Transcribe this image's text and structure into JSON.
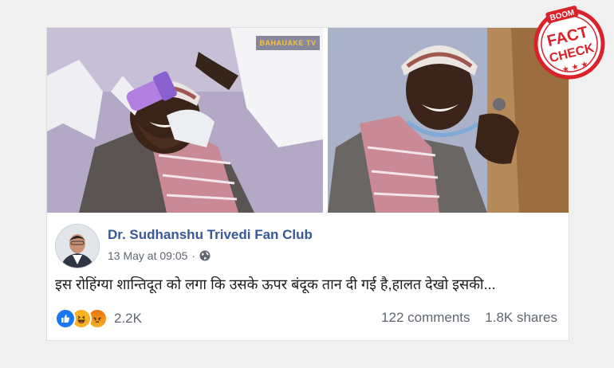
{
  "watermark": "BAHAUAKE TV",
  "post": {
    "page_name": "Dr. Sudhanshu Trivedi Fan Club",
    "timestamp": "13 May at 09:05",
    "separator": "·",
    "text": "इस रोहिंग्या शान्तिदूत को लगा कि उसके ऊपर बंदूक तान दी गई है,हालत देखो इसकी..."
  },
  "engagement": {
    "reactions": [
      "like-icon",
      "haha-icon",
      "angry-icon"
    ],
    "reaction_count": "2.2K",
    "comments": "122 comments",
    "shares": "1.8K shares"
  },
  "stamp": {
    "brand": "BOOM",
    "line1": "FACT",
    "line2": "CHECK",
    "color": "#d9222a"
  },
  "colors": {
    "link_blue": "#385898",
    "like_blue": "#1877f2",
    "muted_text": "#606770"
  }
}
